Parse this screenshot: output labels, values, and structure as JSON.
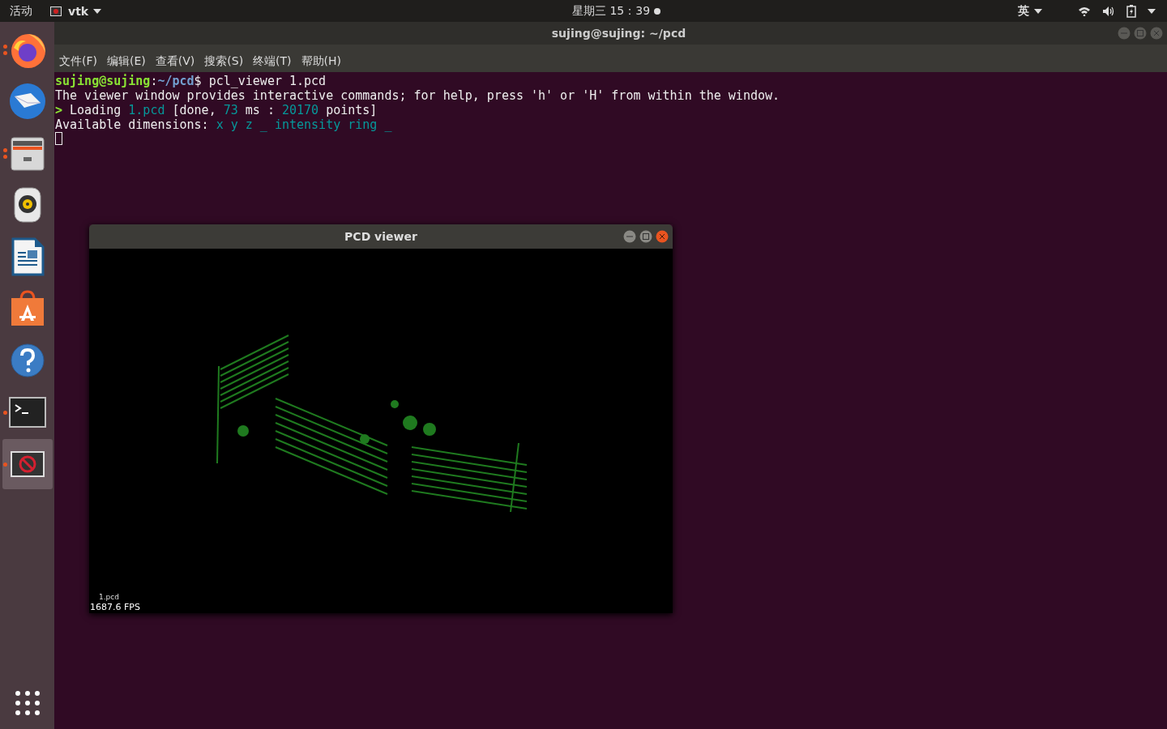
{
  "top_bar": {
    "activities": "活动",
    "app_menu": "vtk",
    "clock": "星期三 15：39",
    "notification": true,
    "input_method": "英"
  },
  "dock": [
    {
      "kind": "firefox",
      "running": true,
      "multiple_windows": true,
      "selected": false
    },
    {
      "kind": "mail",
      "running": false,
      "selected": false
    },
    {
      "kind": "files",
      "running": true,
      "multiple_windows": true,
      "selected": false
    },
    {
      "kind": "music",
      "running": false,
      "selected": false
    },
    {
      "kind": "writer",
      "running": false,
      "selected": false
    },
    {
      "kind": "software",
      "running": false,
      "selected": false
    },
    {
      "kind": "help",
      "running": false,
      "selected": false
    },
    {
      "kind": "terminal",
      "running": true,
      "multiple_windows": false,
      "selected": false
    },
    {
      "kind": "vtk",
      "running": true,
      "multiple_windows": false,
      "selected": true
    }
  ],
  "terminal": {
    "title": "sujing@sujing: ~/pcd",
    "menu": [
      "文件(F)",
      "编辑(E)",
      "查看(V)",
      "搜索(S)",
      "终端(T)",
      "帮助(H)"
    ],
    "lines": [
      [
        {
          "kind": "user",
          "text": "sujing@sujing"
        },
        {
          "kind": "plain",
          "text": ":"
        },
        {
          "kind": "path",
          "text": "~/pcd"
        },
        {
          "kind": "plain",
          "text": "$ pcl_viewer 1.pcd"
        }
      ],
      [
        {
          "kind": "plain",
          "text": "The viewer window provides interactive commands; for help, press 'h' or 'H' from within the window."
        }
      ],
      [
        {
          "kind": "arrow",
          "text": ">"
        },
        {
          "kind": "plain",
          "text": " Loading "
        },
        {
          "kind": "value",
          "text": "1.pcd"
        },
        {
          "kind": "plain",
          "text": " [done, "
        },
        {
          "kind": "value",
          "text": "73"
        },
        {
          "kind": "plain",
          "text": " ms : "
        },
        {
          "kind": "value",
          "text": "20170"
        },
        {
          "kind": "plain",
          "text": " points]"
        }
      ],
      [
        {
          "kind": "plain",
          "text": "Available dimensions: "
        },
        {
          "kind": "value",
          "text": "x y z _ intensity ring _"
        }
      ]
    ]
  },
  "viewer": {
    "title": "PCD viewer",
    "overlay_label": "1.pcd",
    "fps": "1687.6 FPS"
  }
}
